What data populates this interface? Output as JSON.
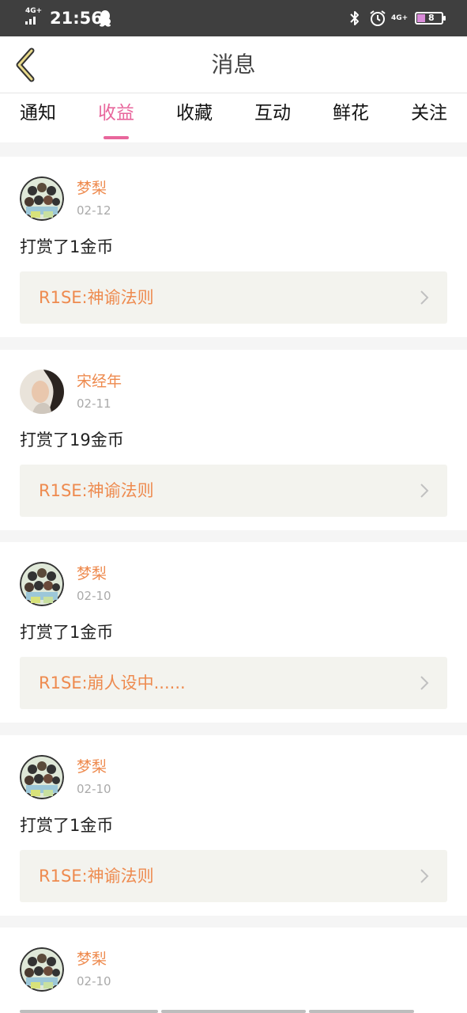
{
  "status_bar": {
    "network_left": "4G+",
    "time": "21:56",
    "network_right": "4G+",
    "battery": "8"
  },
  "header": {
    "title": "消息",
    "back_icon": "chevron-left-icon"
  },
  "tabs": [
    {
      "label": "通知",
      "active": false
    },
    {
      "label": "收益",
      "active": true
    },
    {
      "label": "收藏",
      "active": false
    },
    {
      "label": "互动",
      "active": false
    },
    {
      "label": "鲜花",
      "active": false
    },
    {
      "label": "关注",
      "active": false
    }
  ],
  "colors": {
    "accent_pink": "#e8669c",
    "name_orange": "#ee8a4e",
    "status_bar": "#3f3f3f",
    "link_bg": "#f3f3ee"
  },
  "messages": [
    {
      "name": "梦梨",
      "date": "02-12",
      "reward": "打赏了1金币",
      "work": "R1SE:神谕法则",
      "avatar": "group-cartoon-avatar"
    },
    {
      "name": "宋经年",
      "date": "02-11",
      "reward": "打赏了19金币",
      "work": "R1SE:神谕法则",
      "avatar": "portrait-photo-avatar"
    },
    {
      "name": "梦梨",
      "date": "02-10",
      "reward": "打赏了1金币",
      "work": "R1SE:崩人设中......",
      "avatar": "group-cartoon-avatar"
    },
    {
      "name": "梦梨",
      "date": "02-10",
      "reward": "打赏了1金币",
      "work": "R1SE:神谕法则",
      "avatar": "group-cartoon-avatar"
    },
    {
      "name": "梦梨",
      "date": "02-10",
      "reward": "",
      "work": "",
      "avatar": "group-cartoon-avatar"
    }
  ]
}
